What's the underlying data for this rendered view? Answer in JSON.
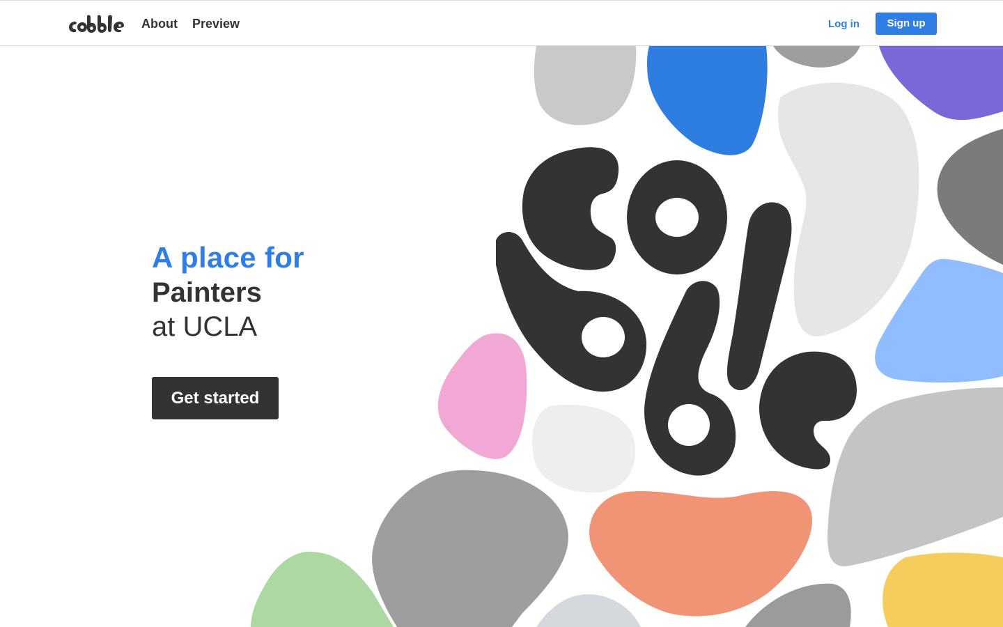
{
  "header": {
    "logo_text": "cobble",
    "nav": {
      "about_label": "About",
      "preview_label": "Preview"
    },
    "login_label": "Log in",
    "signup_label": "Sign up"
  },
  "hero": {
    "line1": "A place for",
    "line2": "Painters",
    "line3": "at UCLA",
    "cta_label": "Get started",
    "art_logo_text": "cobble"
  },
  "colors": {
    "accent_blue": "#2e7ee6",
    "dark": "#333333",
    "pebble_blue": "#2e7de1",
    "pebble_purple": "#7b68d8",
    "pebble_light_blue": "#91bcff",
    "pebble_pink": "#f1a8d4",
    "pebble_orange": "#f19476",
    "pebble_green": "#acd9a1",
    "pebble_yellow": "#f6cc5d",
    "pebble_light_gray": "#e6e6e6",
    "pebble_mid_gray": "#c6c6c6",
    "pebble_dark_gray": "#7b7b7b"
  },
  "icons": {
    "logo": "cobble-wordmark",
    "art": "cobble-pebbles"
  }
}
